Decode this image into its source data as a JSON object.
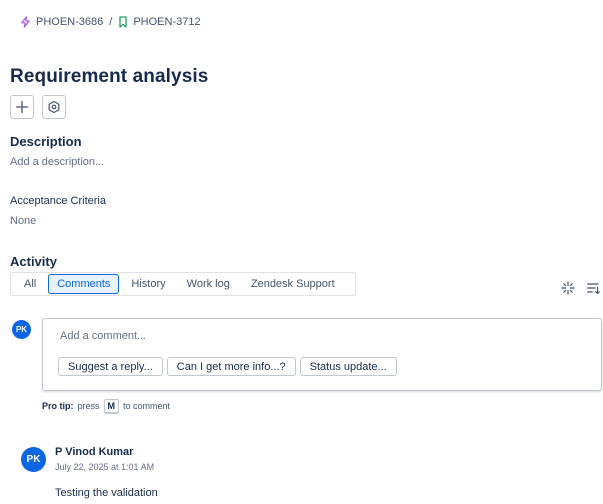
{
  "breadcrumb": {
    "parent_key": "PHOEN-3686",
    "separator": "/",
    "current_key": "PHOEN-3712"
  },
  "issue": {
    "title": "Requirement analysis"
  },
  "description": {
    "heading": "Description",
    "placeholder": "Add a description..."
  },
  "acceptance_criteria": {
    "heading": "Acceptance Criteria",
    "value": "None"
  },
  "activity": {
    "heading": "Activity",
    "tabs": [
      {
        "label": "All"
      },
      {
        "label": "Comments"
      },
      {
        "label": "History"
      },
      {
        "label": "Work log"
      },
      {
        "label": "Zendesk Support"
      }
    ],
    "active_tab": "Comments"
  },
  "comment_editor": {
    "avatar_initials": "PK",
    "placeholder": "Add a comment...",
    "suggestions": [
      {
        "label": "Suggest a reply..."
      },
      {
        "label": "Can I get more info...?"
      },
      {
        "label": "Status update..."
      }
    ]
  },
  "pro_tip": {
    "label": "Pro tip:",
    "text_before": "press",
    "key": "M",
    "text_after": "to comment"
  },
  "comments": [
    {
      "avatar_initials": "PK",
      "author": "P Vinod Kumar",
      "timestamp": "July 22, 2025 at 1:01 AM",
      "body": "Testing the validation"
    }
  ],
  "icons": {
    "parent": "epic-lightning-icon",
    "current": "story-bookmark-icon",
    "add": "plus-icon",
    "apps": "hexagon-settings-icon",
    "sparkle": "sparkle-icon",
    "sort": "sort-icon"
  },
  "colors": {
    "accent": "#0c66e4",
    "epic": "#a25ae8",
    "story": "#22a06b",
    "text": "#172b4d",
    "muted": "#626f86"
  }
}
